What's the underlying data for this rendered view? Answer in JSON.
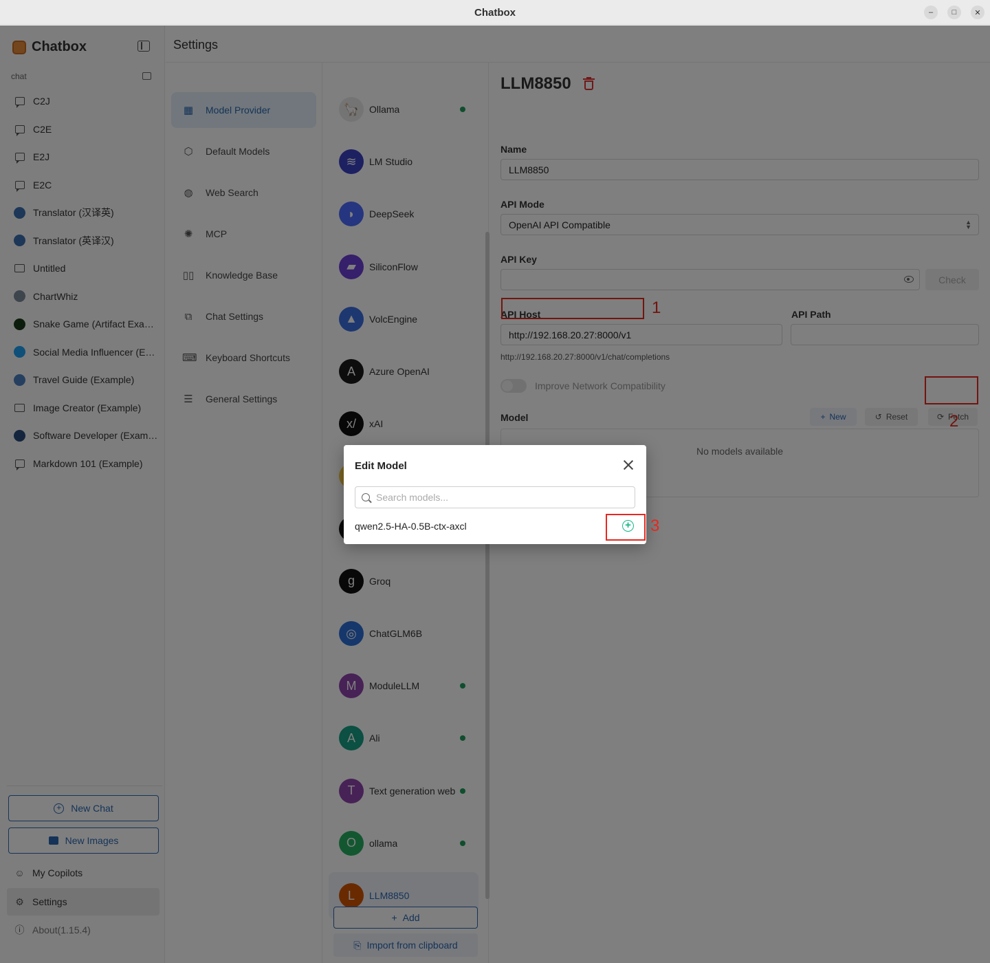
{
  "window": {
    "title": "Chatbox",
    "min_glyph": "–",
    "max_glyph": "□",
    "close_glyph": "✕"
  },
  "sidebar": {
    "app_name": "Chatbox",
    "section_label": "chat",
    "sessions": [
      {
        "label": "C2J",
        "icon": "chat-bubble-icon"
      },
      {
        "label": "C2E",
        "icon": "chat-bubble-icon"
      },
      {
        "label": "E2J",
        "icon": "chat-bubble-icon"
      },
      {
        "label": "E2C",
        "icon": "chat-bubble-icon"
      },
      {
        "label": "Translator (汉译英)",
        "icon": "translator-avatar"
      },
      {
        "label": "Translator (英译汉)",
        "icon": "translator-avatar"
      },
      {
        "label": "Untitled",
        "icon": "image-icon"
      },
      {
        "label": "ChartWhiz",
        "icon": "chartwhiz-avatar"
      },
      {
        "label": "Snake Game (Artifact Example)",
        "icon": "snake-avatar"
      },
      {
        "label": "Social Media Influencer (Example)",
        "icon": "twitter-avatar"
      },
      {
        "label": "Travel Guide (Example)",
        "icon": "globe-avatar"
      },
      {
        "label": "Image Creator (Example)",
        "icon": "image-icon"
      },
      {
        "label": "Software Developer (Example)",
        "icon": "developer-avatar"
      },
      {
        "label": "Markdown 101 (Example)",
        "icon": "chat-bubble-icon"
      }
    ],
    "new_chat": "New Chat",
    "new_images": "New Images",
    "my_copilots": "My Copilots",
    "settings": "Settings",
    "about": "About(1.15.4)"
  },
  "settings": {
    "title": "Settings",
    "nav": [
      {
        "label": "Model Provider",
        "icon": "grid-icon",
        "glyph": "▦"
      },
      {
        "label": "Default Models",
        "icon": "cube-icon",
        "glyph": "⬡"
      },
      {
        "label": "Web Search",
        "icon": "globe-icon",
        "glyph": "◍"
      },
      {
        "label": "MCP",
        "icon": "mcp-icon",
        "glyph": "✺"
      },
      {
        "label": "Knowledge Base",
        "icon": "book-icon",
        "glyph": "▯▯"
      },
      {
        "label": "Chat Settings",
        "icon": "chat-settings-icon",
        "glyph": "⧉"
      },
      {
        "label": "Keyboard Shortcuts",
        "icon": "keyboard-icon",
        "glyph": "⌨"
      },
      {
        "label": "General Settings",
        "icon": "sliders-icon",
        "glyph": "☰"
      }
    ]
  },
  "providers": {
    "items": [
      {
        "name": "Ollama",
        "initial": "🦙",
        "color": "#e9e9e9",
        "dot": true
      },
      {
        "name": "LM Studio",
        "initial": "≋",
        "color": "#3b42c4",
        "dot": false
      },
      {
        "name": "DeepSeek",
        "initial": "◗",
        "color": "#4d6bfe",
        "dot": false
      },
      {
        "name": "SiliconFlow",
        "initial": "▰",
        "color": "#6d3fd6",
        "dot": false
      },
      {
        "name": "VolcEngine",
        "initial": "▲",
        "color": "#3b6fe0",
        "dot": false
      },
      {
        "name": "Azure OpenAI",
        "initial": "A",
        "color": "#1a1a1a",
        "dot": false
      },
      {
        "name": "xAI",
        "initial": "x/",
        "color": "#111111",
        "dot": false
      },
      {
        "name": "",
        "initial": "",
        "color": "#f7c948",
        "dot": false
      },
      {
        "name": "",
        "initial": "",
        "color": "#111111",
        "dot": false
      },
      {
        "name": "Groq",
        "initial": "g",
        "color": "#111111",
        "dot": false
      },
      {
        "name": "ChatGLM6B",
        "initial": "◎",
        "color": "#2d6fd6",
        "dot": false
      },
      {
        "name": "ModuleLLM",
        "initial": "M",
        "color": "#8e44ad",
        "dot": true
      },
      {
        "name": "Ali",
        "initial": "A",
        "color": "#16a085",
        "dot": true
      },
      {
        "name": "Text generation web",
        "initial": "T",
        "color": "#8e44ad",
        "dot": true
      },
      {
        "name": "ollama",
        "initial": "O",
        "color": "#27ae60",
        "dot": true
      },
      {
        "name": "LLM8850",
        "initial": "L",
        "color": "#d35400",
        "dot": false
      }
    ],
    "add": "Add",
    "import": "Import from clipboard"
  },
  "detail": {
    "title": "LLM8850",
    "name_label": "Name",
    "name_value": "LLM8850",
    "api_mode_label": "API Mode",
    "api_mode_value": "OpenAI API Compatible",
    "api_key_label": "API Key",
    "api_key_value": "",
    "check": "Check",
    "api_host_label": "API Host",
    "api_host_value": "http://192.168.20.27:8000/v1",
    "api_path_label": "API Path",
    "api_path_value": "",
    "endpoint_hint": "http://192.168.20.27:8000/v1/chat/completions",
    "improve_network": "Improve Network Compatibility",
    "model_label": "Model",
    "new": "New",
    "reset": "Reset",
    "fetch": "Fetch",
    "no_models": "No models available"
  },
  "annotations": {
    "one": "1",
    "two": "2",
    "three": "3",
    "color": "#e5281f"
  },
  "modal": {
    "title": "Edit Model",
    "search_placeholder": "Search models...",
    "model_name": "qwen2.5-HA-0.5B-ctx-axcl",
    "add_glyph": "+"
  },
  "colors": {
    "accent": "#2a67b0",
    "status_dot": "#1f9d5a",
    "add_green": "#12b886",
    "danger": "#e03131"
  }
}
